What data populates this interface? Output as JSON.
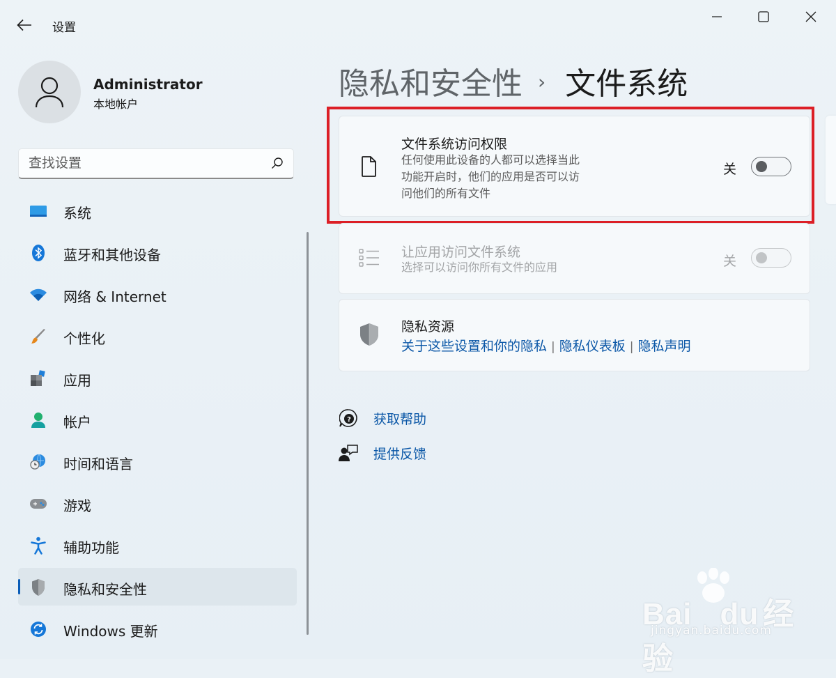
{
  "window": {
    "title": "设置",
    "controls": [
      "minimize-icon",
      "maximize-icon",
      "close-icon"
    ]
  },
  "user": {
    "name": "Administrator",
    "account_type": "本地帐户"
  },
  "search": {
    "placeholder": "查找设置"
  },
  "sidebar": {
    "items": [
      {
        "label": "系统",
        "icon": "monitor-icon"
      },
      {
        "label": "蓝牙和其他设备",
        "icon": "bluetooth-icon"
      },
      {
        "label": "网络 & Internet",
        "icon": "wifi-icon"
      },
      {
        "label": "个性化",
        "icon": "brush-icon"
      },
      {
        "label": "应用",
        "icon": "apps-icon"
      },
      {
        "label": "帐户",
        "icon": "person-icon"
      },
      {
        "label": "时间和语言",
        "icon": "globe-clock-icon"
      },
      {
        "label": "游戏",
        "icon": "gamepad-icon"
      },
      {
        "label": "辅助功能",
        "icon": "accessibility-icon"
      },
      {
        "label": "隐私和安全性",
        "icon": "shield-icon",
        "selected": true
      },
      {
        "label": "Windows 更新",
        "icon": "update-icon"
      }
    ]
  },
  "breadcrumb": {
    "parent": "隐私和安全性",
    "separator": "›",
    "current": "文件系统"
  },
  "settings": {
    "file_access": {
      "title": "文件系统访问权限",
      "description": "任何使用此设备的人都可以选择当此功能开启时，他们的应用是否可以访问他们的所有文件",
      "description_lines": [
        "任何使用此设备的人都可以选择当此",
        "功能开启时，他们的应用是否可以访",
        "问他们的所有文件"
      ],
      "state_label": "关",
      "enabled": false,
      "icon": "document-icon"
    },
    "app_access": {
      "title": "让应用访问文件系统",
      "description": "选择可以访问你所有文件的应用",
      "state_label": "关",
      "enabled": false,
      "disabled": true,
      "icon": "list-icon"
    },
    "privacy_resources": {
      "title": "隐私资源",
      "links": [
        "关于这些设置和你的隐私",
        "隐私仪表板",
        "隐私声明"
      ],
      "icon": "shield-icon"
    }
  },
  "help": {
    "get_help": "获取帮助",
    "feedback": "提供反馈"
  },
  "watermark": {
    "brand": "Bai",
    "brand_suffix": "du",
    "brand_cn": "经验",
    "url": "jingyan.baidu.com"
  },
  "colors": {
    "highlight_border": "#dc1f26",
    "accent": "#0a5db8",
    "link": "#0b57a7"
  }
}
